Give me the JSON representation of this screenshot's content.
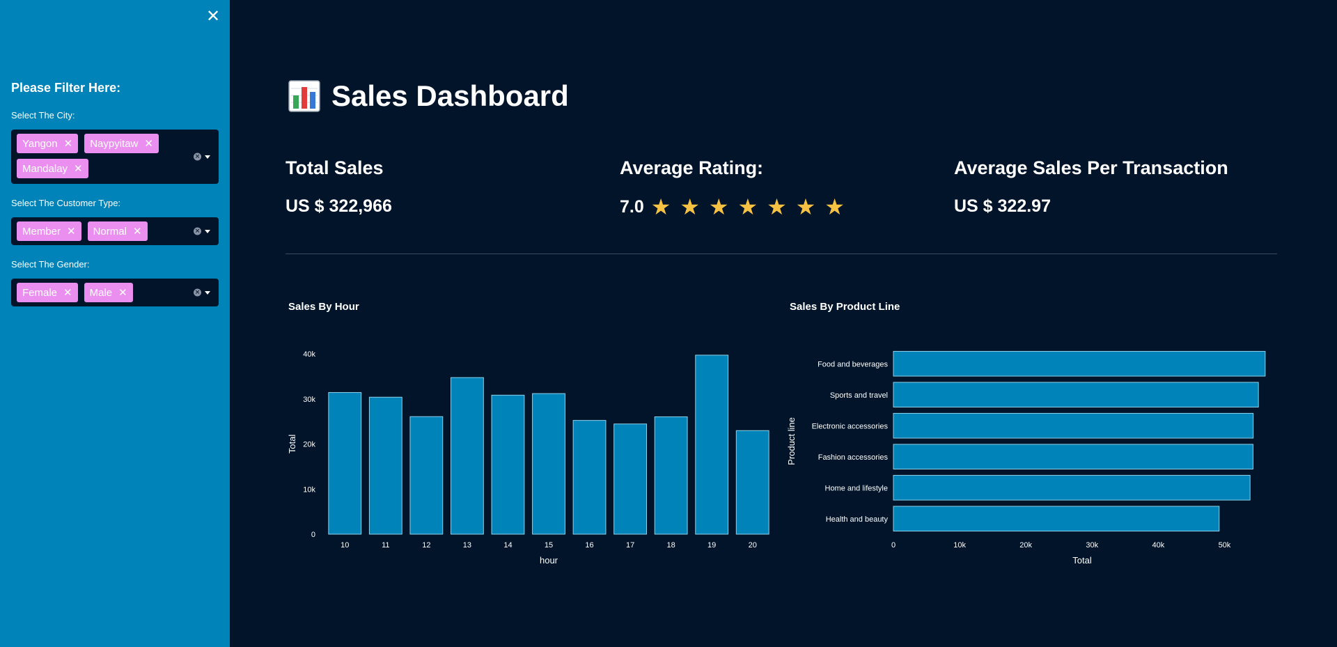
{
  "sidebar": {
    "close_icon": "close-icon",
    "header": "Please Filter Here:",
    "filters": [
      {
        "label": "Select The City:",
        "tags": [
          "Yangon",
          "Naypyitaw",
          "Mandalay"
        ]
      },
      {
        "label": "Select The Customer Type:",
        "tags": [
          "Member",
          "Normal"
        ]
      },
      {
        "label": "Select The Gender:",
        "tags": [
          "Female",
          "Male"
        ]
      }
    ],
    "tag_color": "#ea8ef0",
    "background": "#0083b8"
  },
  "main": {
    "title": "Sales Dashboard",
    "title_icon": "bar-chart-icon",
    "metrics": {
      "total_sales_label": "Total Sales",
      "total_sales_value": "US $ 322,966",
      "avg_rating_label": "Average Rating:",
      "avg_rating_value": "7.0",
      "stars": "★ ★ ★ ★ ★ ★ ★",
      "avg_sales_label": "Average Sales Per Transaction",
      "avg_sales_value": "US $ 322.97"
    }
  },
  "chart_data": [
    {
      "type": "bar",
      "title": "Sales By Hour",
      "xlabel": "hour",
      "ylabel": "Total",
      "categories": [
        "10",
        "11",
        "12",
        "13",
        "14",
        "15",
        "16",
        "17",
        "18",
        "19",
        "20"
      ],
      "values": [
        31420,
        30380,
        26070,
        34730,
        30830,
        31180,
        25230,
        24440,
        26030,
        39700,
        22970
      ],
      "ylim": [
        0,
        40000
      ],
      "yticks": [
        "0",
        "10k",
        "20k",
        "30k",
        "40k"
      ],
      "color": "#0083b8",
      "grid": false
    },
    {
      "type": "bar",
      "orientation": "horizontal",
      "title": "Sales By Product Line",
      "xlabel": "Total",
      "ylabel": "Product line",
      "categories": [
        "Food and beverages",
        "Sports and travel",
        "Electronic accessories",
        "Fashion accessories",
        "Home and lifestyle",
        "Health and beauty"
      ],
      "values": [
        56145,
        55123,
        54338,
        54306,
        53862,
        49194
      ],
      "xlim": [
        0,
        57000
      ],
      "xticks": [
        "0",
        "10k",
        "20k",
        "30k",
        "40k",
        "50k"
      ],
      "color": "#0083b8",
      "grid": false
    }
  ]
}
